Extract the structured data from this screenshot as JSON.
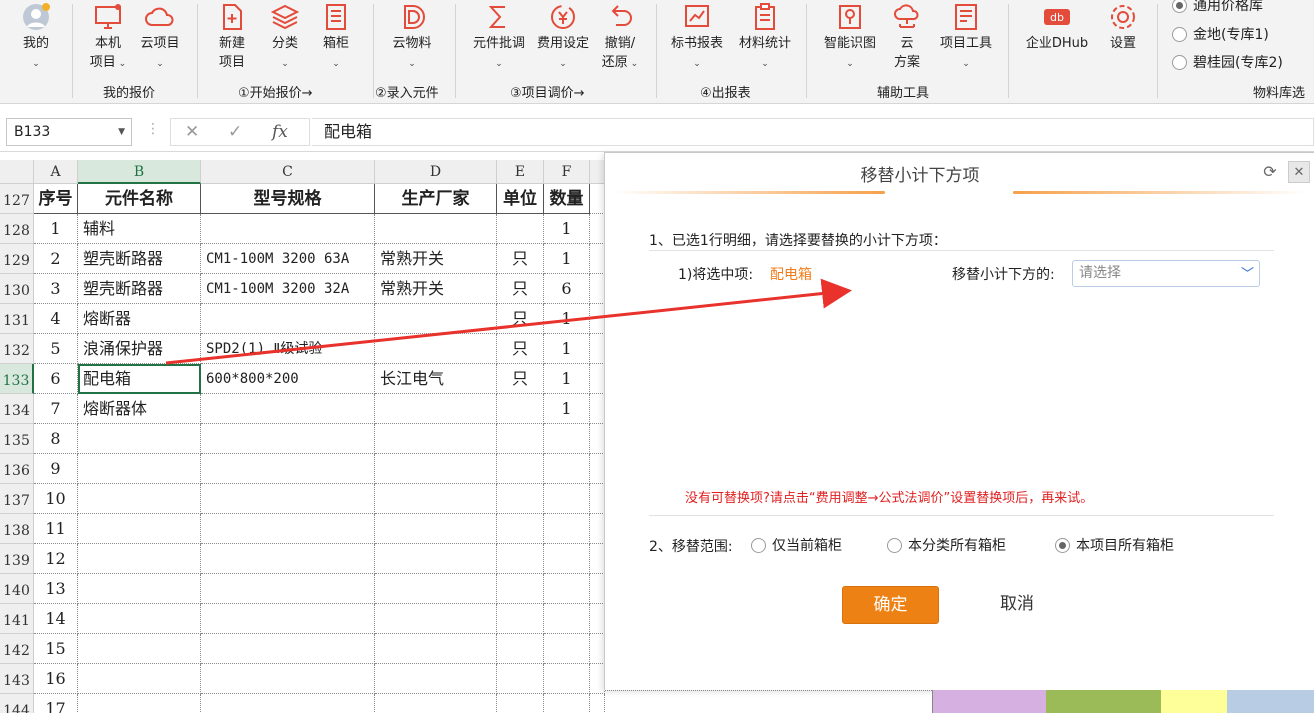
{
  "ribbon": {
    "buttons": [
      {
        "label1": "我的",
        "label2": "",
        "caret": true,
        "icon": "user-avatar-icon"
      },
      {
        "label1": "本机",
        "label2": "项目",
        "caret": true,
        "icon": "monitor-icon"
      },
      {
        "label1": "云项目",
        "label2": "",
        "caret": true,
        "icon": "cloud-icon"
      },
      {
        "label1": "新建",
        "label2": "项目",
        "caret": false,
        "icon": "new-file-icon"
      },
      {
        "label1": "分类",
        "label2": "",
        "caret": true,
        "icon": "layers-icon"
      },
      {
        "label1": "箱柜",
        "label2": "",
        "caret": true,
        "icon": "cabinet-icon"
      },
      {
        "label1": "云物料",
        "label2": "",
        "caret": true,
        "icon": "database-icon"
      },
      {
        "label1": "元件批调",
        "label2": "",
        "caret": true,
        "icon": "sigma-icon"
      },
      {
        "label1": "费用设定",
        "label2": "",
        "caret": true,
        "icon": "money-icon"
      },
      {
        "label1": "撤销/",
        "label2": "还原",
        "caret": true,
        "icon": "undo-icon"
      },
      {
        "label1": "标书报表",
        "label2": "",
        "caret": true,
        "icon": "report-chart-icon"
      },
      {
        "label1": "材料统计",
        "label2": "",
        "caret": true,
        "icon": "clipboard-icon"
      },
      {
        "label1": "智能识图",
        "label2": "",
        "caret": true,
        "icon": "smart-scan-icon"
      },
      {
        "label1": "云",
        "label2": "方案",
        "caret": false,
        "icon": "cloud-network-icon"
      },
      {
        "label1": "项目工具",
        "label2": "",
        "caret": true,
        "icon": "tools-doc-icon"
      },
      {
        "label1": "企业DHub",
        "label2": "",
        "caret": false,
        "icon": "dhub-logo-icon"
      },
      {
        "label1": "设置",
        "label2": "",
        "caret": false,
        "icon": "gear-icon"
      }
    ],
    "groups": [
      "我的报价",
      "①开始报价→",
      "②录入元件",
      "③项目调价→",
      "④出报表",
      "辅助工具",
      "物料库选"
    ],
    "libraries": [
      {
        "label": "通用价格库",
        "selected": true
      },
      {
        "label": "金地(专库1)",
        "selected": false
      },
      {
        "label": "碧桂园(专库2)",
        "selected": false
      }
    ]
  },
  "formula_bar": {
    "name_box": "B133",
    "cancel": "✕",
    "confirm": "✓",
    "fx": "fx",
    "value": "配电箱"
  },
  "sheet": {
    "col_headers": [
      "A",
      "B",
      "C",
      "D",
      "E",
      "F"
    ],
    "header_row": {
      "row_num": "127",
      "cells": [
        "序号",
        "元件名称",
        "型号规格",
        "生产厂家",
        "单位",
        "数量"
      ]
    },
    "rows": [
      {
        "row_num": "128",
        "cells": [
          "1",
          "辅料",
          "",
          "",
          "",
          "1"
        ]
      },
      {
        "row_num": "129",
        "cells": [
          "2",
          "塑壳断路器",
          "CM1-100M 3200 63A",
          "常熟开关",
          "只",
          "1"
        ]
      },
      {
        "row_num": "130",
        "cells": [
          "3",
          "塑壳断路器",
          "CM1-100M 3200 32A",
          "常熟开关",
          "只",
          "6"
        ]
      },
      {
        "row_num": "131",
        "cells": [
          "4",
          "熔断器",
          "",
          "",
          "只",
          "1"
        ]
      },
      {
        "row_num": "132",
        "cells": [
          "5",
          "浪涌保护器",
          "SPD2(1) Ⅱ级试验",
          "",
          "只",
          "1"
        ]
      },
      {
        "row_num": "133",
        "cells": [
          "6",
          "配电箱",
          "600*800*200",
          "长江电气",
          "只",
          "1"
        ]
      },
      {
        "row_num": "134",
        "cells": [
          "7",
          "熔断器体",
          "",
          "",
          "",
          "1"
        ]
      },
      {
        "row_num": "135",
        "cells": [
          "8",
          "",
          "",
          "",
          "",
          ""
        ]
      },
      {
        "row_num": "136",
        "cells": [
          "9",
          "",
          "",
          "",
          "",
          ""
        ]
      },
      {
        "row_num": "137",
        "cells": [
          "10",
          "",
          "",
          "",
          "",
          ""
        ]
      },
      {
        "row_num": "138",
        "cells": [
          "11",
          "",
          "",
          "",
          "",
          ""
        ]
      },
      {
        "row_num": "139",
        "cells": [
          "12",
          "",
          "",
          "",
          "",
          ""
        ]
      },
      {
        "row_num": "140",
        "cells": [
          "13",
          "",
          "",
          "",
          "",
          ""
        ]
      },
      {
        "row_num": "141",
        "cells": [
          "14",
          "",
          "",
          "",
          "",
          ""
        ]
      },
      {
        "row_num": "142",
        "cells": [
          "15",
          "",
          "",
          "",
          "",
          ""
        ]
      },
      {
        "row_num": "143",
        "cells": [
          "16",
          "",
          "",
          "",
          "",
          ""
        ]
      },
      {
        "row_num": "144",
        "cells": [
          "17",
          "",
          "",
          "",
          "",
          ""
        ]
      }
    ],
    "active_cell": "B133"
  },
  "dialog": {
    "title": "移替小计下方项",
    "step1": "1、已选1行明细，请选择要替换的小计下方项：",
    "selected_label": "1)将选中项:",
    "selected_value": "配电箱",
    "target_label": "移替小计下方的:",
    "target_placeholder": "请选择",
    "hint": "没有可替换项?请点击“费用调整→公式法调价”设置替换项后，再来试。",
    "step2": "2、移替范围:",
    "scope_options": [
      {
        "label": "仅当前箱柜",
        "selected": false
      },
      {
        "label": "本分类所有箱柜",
        "selected": false
      },
      {
        "label": "本项目所有箱柜",
        "selected": true
      }
    ],
    "ok_label": "确定",
    "cancel_label": "取消"
  },
  "colors": {
    "accent_orange": "#ee8114",
    "hint_red": "#e02020",
    "highlight_orange": "#f07d1a",
    "selection_green": "#217346",
    "arrow_red": "#e8322b",
    "strip_purple": "#d5b0e0",
    "strip_green": "#9bbb59",
    "strip_yellow": "#ffff99",
    "strip_blue": "#b8cce4"
  }
}
